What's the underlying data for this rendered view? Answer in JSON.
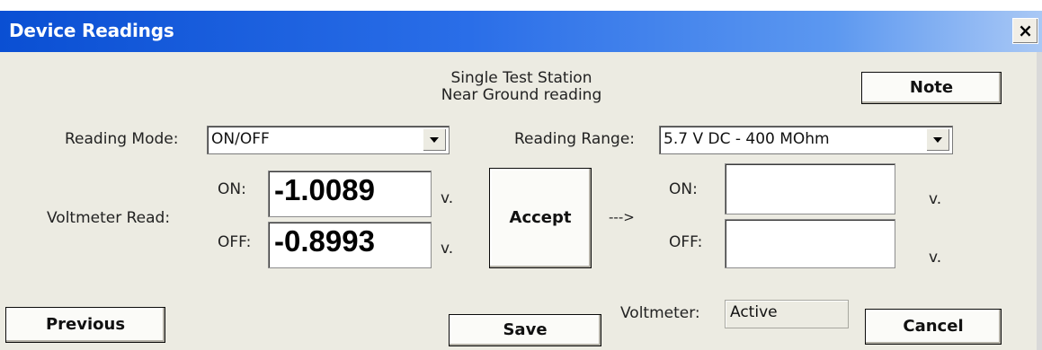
{
  "window": {
    "title": "Device Readings",
    "close_glyph": "×"
  },
  "header": {
    "line1": "Single Test Station",
    "line2": "Near Ground reading"
  },
  "note_button": "Note",
  "reading_mode": {
    "label": "Reading Mode:",
    "value": "ON/OFF"
  },
  "reading_range": {
    "label": "Reading Range:",
    "value": "5.7 V DC - 400 MOhm"
  },
  "voltmeter_read": {
    "label": "Voltmeter Read:",
    "on_label": "ON:",
    "off_label": "OFF:",
    "on_value": "-1.0089",
    "off_value": "-0.8993",
    "unit": "v."
  },
  "accept_button": "Accept",
  "arrow_text": "--->",
  "accepted": {
    "on_label": "ON:",
    "off_label": "OFF:",
    "on_value": "",
    "off_value": "",
    "unit": "v."
  },
  "voltmeter_status": {
    "label": "Voltmeter:",
    "value": "Active"
  },
  "buttons": {
    "previous": "Previous",
    "save": "Save",
    "cancel": "Cancel"
  }
}
